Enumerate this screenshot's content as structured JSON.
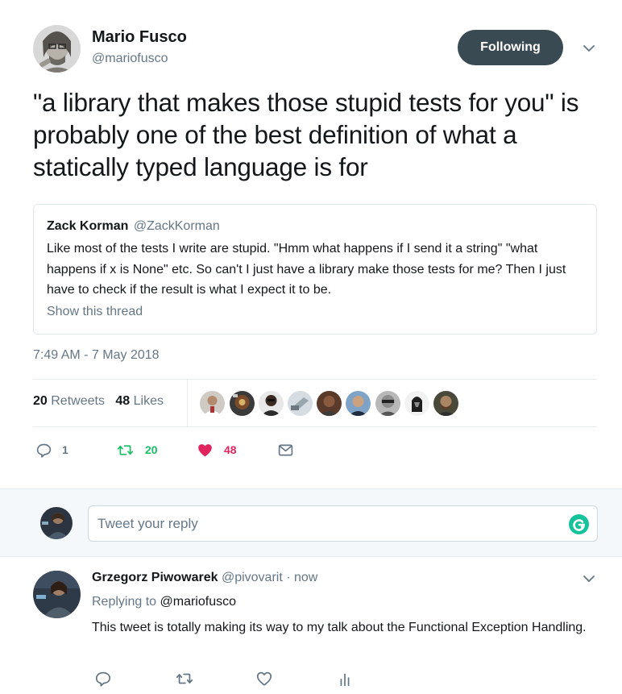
{
  "tweet": {
    "author": {
      "name": "Mario Fusco",
      "handle": "@mariofusco"
    },
    "follow_label": "Following",
    "text": "\"a library that makes those stupid tests for you\" is probably one of the best definition of what a statically typed language is for",
    "quoted": {
      "name": "Zack Korman",
      "handle": "@ZackKorman",
      "text": "Like most of the tests I write are stupid. \"Hmm what happens if I send it a string\" \"what happens if x is None\" etc. So can't I just have a library make those tests for me? Then I just have to check if the result is what I expect it to be.",
      "show_thread": "Show this thread"
    },
    "timestamp": "7:49 AM - 7 May 2018",
    "stats": {
      "retweets_count": "20",
      "retweets_label": "Retweets",
      "likes_count": "48",
      "likes_label": "Likes"
    },
    "actions": {
      "replies": "1",
      "retweets": "20",
      "likes": "48"
    }
  },
  "composer": {
    "placeholder": "Tweet your reply"
  },
  "reply": {
    "name": "Grzegorz Piwowarek",
    "handle": "@pivovarit",
    "time": "· now",
    "replying_label": "Replying to",
    "replying_to": "@mariofusco",
    "text": "This tweet is totally making its way to my talk about the Functional Exception Handling."
  },
  "colors": {
    "follow_button": "#394a52",
    "retweet_green": "#17bf63",
    "like_red": "#e0245e",
    "secondary_text": "#657786",
    "grammarly": "#15c39a"
  },
  "icons": [
    "chevron-down-icon",
    "reply-icon",
    "retweet-icon",
    "heart-icon",
    "mail-icon",
    "grammarly-icon",
    "analytics-icon"
  ]
}
